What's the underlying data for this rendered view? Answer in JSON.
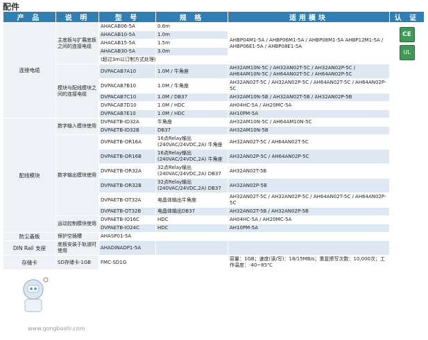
{
  "page_title": "配件",
  "headers": [
    "产 品",
    "说 明",
    "型 号",
    "规 格",
    "适用模块",
    "认 证"
  ],
  "certs": {
    "ce": "CE",
    "ul": "UL"
  },
  "groups": {
    "cable": {
      "product": "连接电缆",
      "sub1": {
        "desc": "主底板与扩展底板之间的连接电缆",
        "rows": [
          {
            "model": "AHACAB06-5A",
            "spec": "0.6m"
          },
          {
            "model": "AHACAB10-5A",
            "spec": "1.0m"
          },
          {
            "model": "AHACAB15-5A",
            "spec": "1.5m"
          },
          {
            "model": "AHACAB30-5A",
            "spec": "3.0m"
          }
        ],
        "note": "(超过3m以订制方式处理)",
        "module": "AHBP04M1-5A / AHBP06M1-5A / AHBP08M1-5A AHBP12M1-5A / AHBP06E1-5A / AHBP08E1-5A"
      },
      "sub2": {
        "desc": "模块与配线模块之间的连接电缆",
        "rows": [
          {
            "model": "DVPACAB7A10",
            "spec": "1.0M / 牛角座",
            "module": "AH32AM10N-5C / AH32AN02T-5C / AH32AN02P-5C / AH64AM10N-5C / AH64AN02T-5C / AH64AN02P-5C"
          },
          {
            "model": "DVPACAB7B10",
            "spec": "1.0M / 牛角座",
            "module": "AH32AN02T-5C / AH32AN02P-5C / AH64AN02T-5C / AH64AN02P-5C"
          },
          {
            "model": "DVPACAB7C10",
            "spec": "1.0M / DB37",
            "module": "AH32AM10N-5B / AH32AN02T-5B / AH32AN02P-5B"
          },
          {
            "model": "DVPACAB7D10",
            "spec": "1.0M / HDC",
            "module": "AH04HC-5A / AH20MC-5A"
          },
          {
            "model": "DVPACAB7E10",
            "spec": "1.0M / HDC",
            "module": "AH10PM-5A"
          }
        ]
      }
    },
    "wiring": {
      "product": "配线模块",
      "din": {
        "desc": "数字输入模块使用",
        "rows": [
          {
            "model": "DVPAETB-ID32A",
            "spec": "牛角座",
            "module": "AH32AM10N-5C / AH64AM10N-5C"
          },
          {
            "model": "DVPAETB-ID32B",
            "spec": "DB37",
            "module": "AH32AM10N-5B"
          }
        ]
      },
      "dout": {
        "desc": "数字输出模块使用",
        "rows": [
          {
            "model": "DVPAETB-OR16A",
            "spec": "16点Relay输出 (240VAC/24VDC,2A) 牛角座",
            "module": "AH32AN02T-5C / AH64AN02T-5C"
          },
          {
            "model": "DVPAETB-OR16B",
            "spec": "16点Relay输出 (240VAC/24VDC,2A) 牛角座",
            "module": "AH32AN02P-5C / AH64AN02P-5C"
          },
          {
            "model": "DVPAETB-OR32A",
            "spec": "32点Relay输出 (240VAC/24VDC,2A) DB37",
            "module": "AH32AN02T-5B"
          },
          {
            "model": "DVPAETB-OR32B",
            "spec": "32点Relay输出 (240VAC/24VDC,2A) DB37",
            "module": "AH32AN02P-5B"
          },
          {
            "model": "DVPAETB-OT32A",
            "spec": "电晶体输出牛角座",
            "module": "AH32AN02T-5C / AH32AN02P-5C / AH64AN02T-5C / AH64AN02P-5C"
          },
          {
            "model": "DVPAETB-OT32B",
            "spec": "电晶体输出DB37",
            "module": "AH32AN02T-5B / AH32AN02P-5B"
          }
        ]
      },
      "motion": {
        "desc": "运动控制模块使用",
        "rows": [
          {
            "model": "DVPAETB-IO16C",
            "spec": "HDC",
            "module": "AH04HC-5A / AH20MC-5A"
          },
          {
            "model": "DVPAETB-IO24C",
            "spec": "HDC",
            "module": "AH10PM-5A"
          }
        ]
      }
    },
    "other": {
      "r1": {
        "product": "防尘盖板",
        "desc": "保护空插槽",
        "model": "AHASP01-5A"
      },
      "r2": {
        "product": "DIN Rail 支座",
        "desc": "底板安装于轨道时使用",
        "model": "AHADINADP1-5A"
      },
      "r3": {
        "product": "存储卡",
        "desc": "SD存储卡-1GB",
        "model": "FMC-SD1G",
        "module": "容量：1GB；速度(读/写)：18/15MB/s；重复擦写次数：10,000次；工作温度：-40~85℃"
      }
    }
  },
  "watermark": "www.gongboshi.com"
}
